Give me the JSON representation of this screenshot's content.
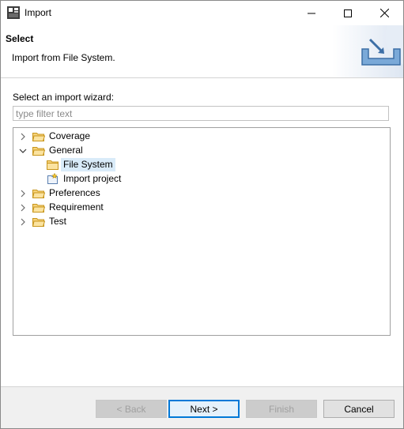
{
  "window": {
    "title": "Import",
    "app_icon": "eclipse-app-icon"
  },
  "banner": {
    "title": "Select",
    "message": "Import from File System.",
    "art_icon": "import-tray-icon"
  },
  "main": {
    "wizard_label": "Select an import wizard:",
    "filter": {
      "placeholder": "type filter text",
      "value": ""
    },
    "tree": [
      {
        "label": "Coverage",
        "expanded": false,
        "icon": "folder-icon"
      },
      {
        "label": "General",
        "expanded": true,
        "icon": "folder-open-icon",
        "children": [
          {
            "label": "File System",
            "icon": "folder-icon",
            "selected": true
          },
          {
            "label": "Import project",
            "icon": "import-project-icon",
            "selected": false
          }
        ]
      },
      {
        "label": "Preferences",
        "expanded": false,
        "icon": "folder-icon"
      },
      {
        "label": "Requirement",
        "expanded": false,
        "icon": "folder-icon"
      },
      {
        "label": "Test",
        "expanded": false,
        "icon": "folder-icon"
      }
    ]
  },
  "footer": {
    "back_label": "< Back",
    "next_label": "Next >",
    "finish_label": "Finish",
    "cancel_label": "Cancel"
  },
  "colors": {
    "selection": "#d9ebf9",
    "default_button_border": "#0078d7",
    "folder": "#e8b445"
  }
}
